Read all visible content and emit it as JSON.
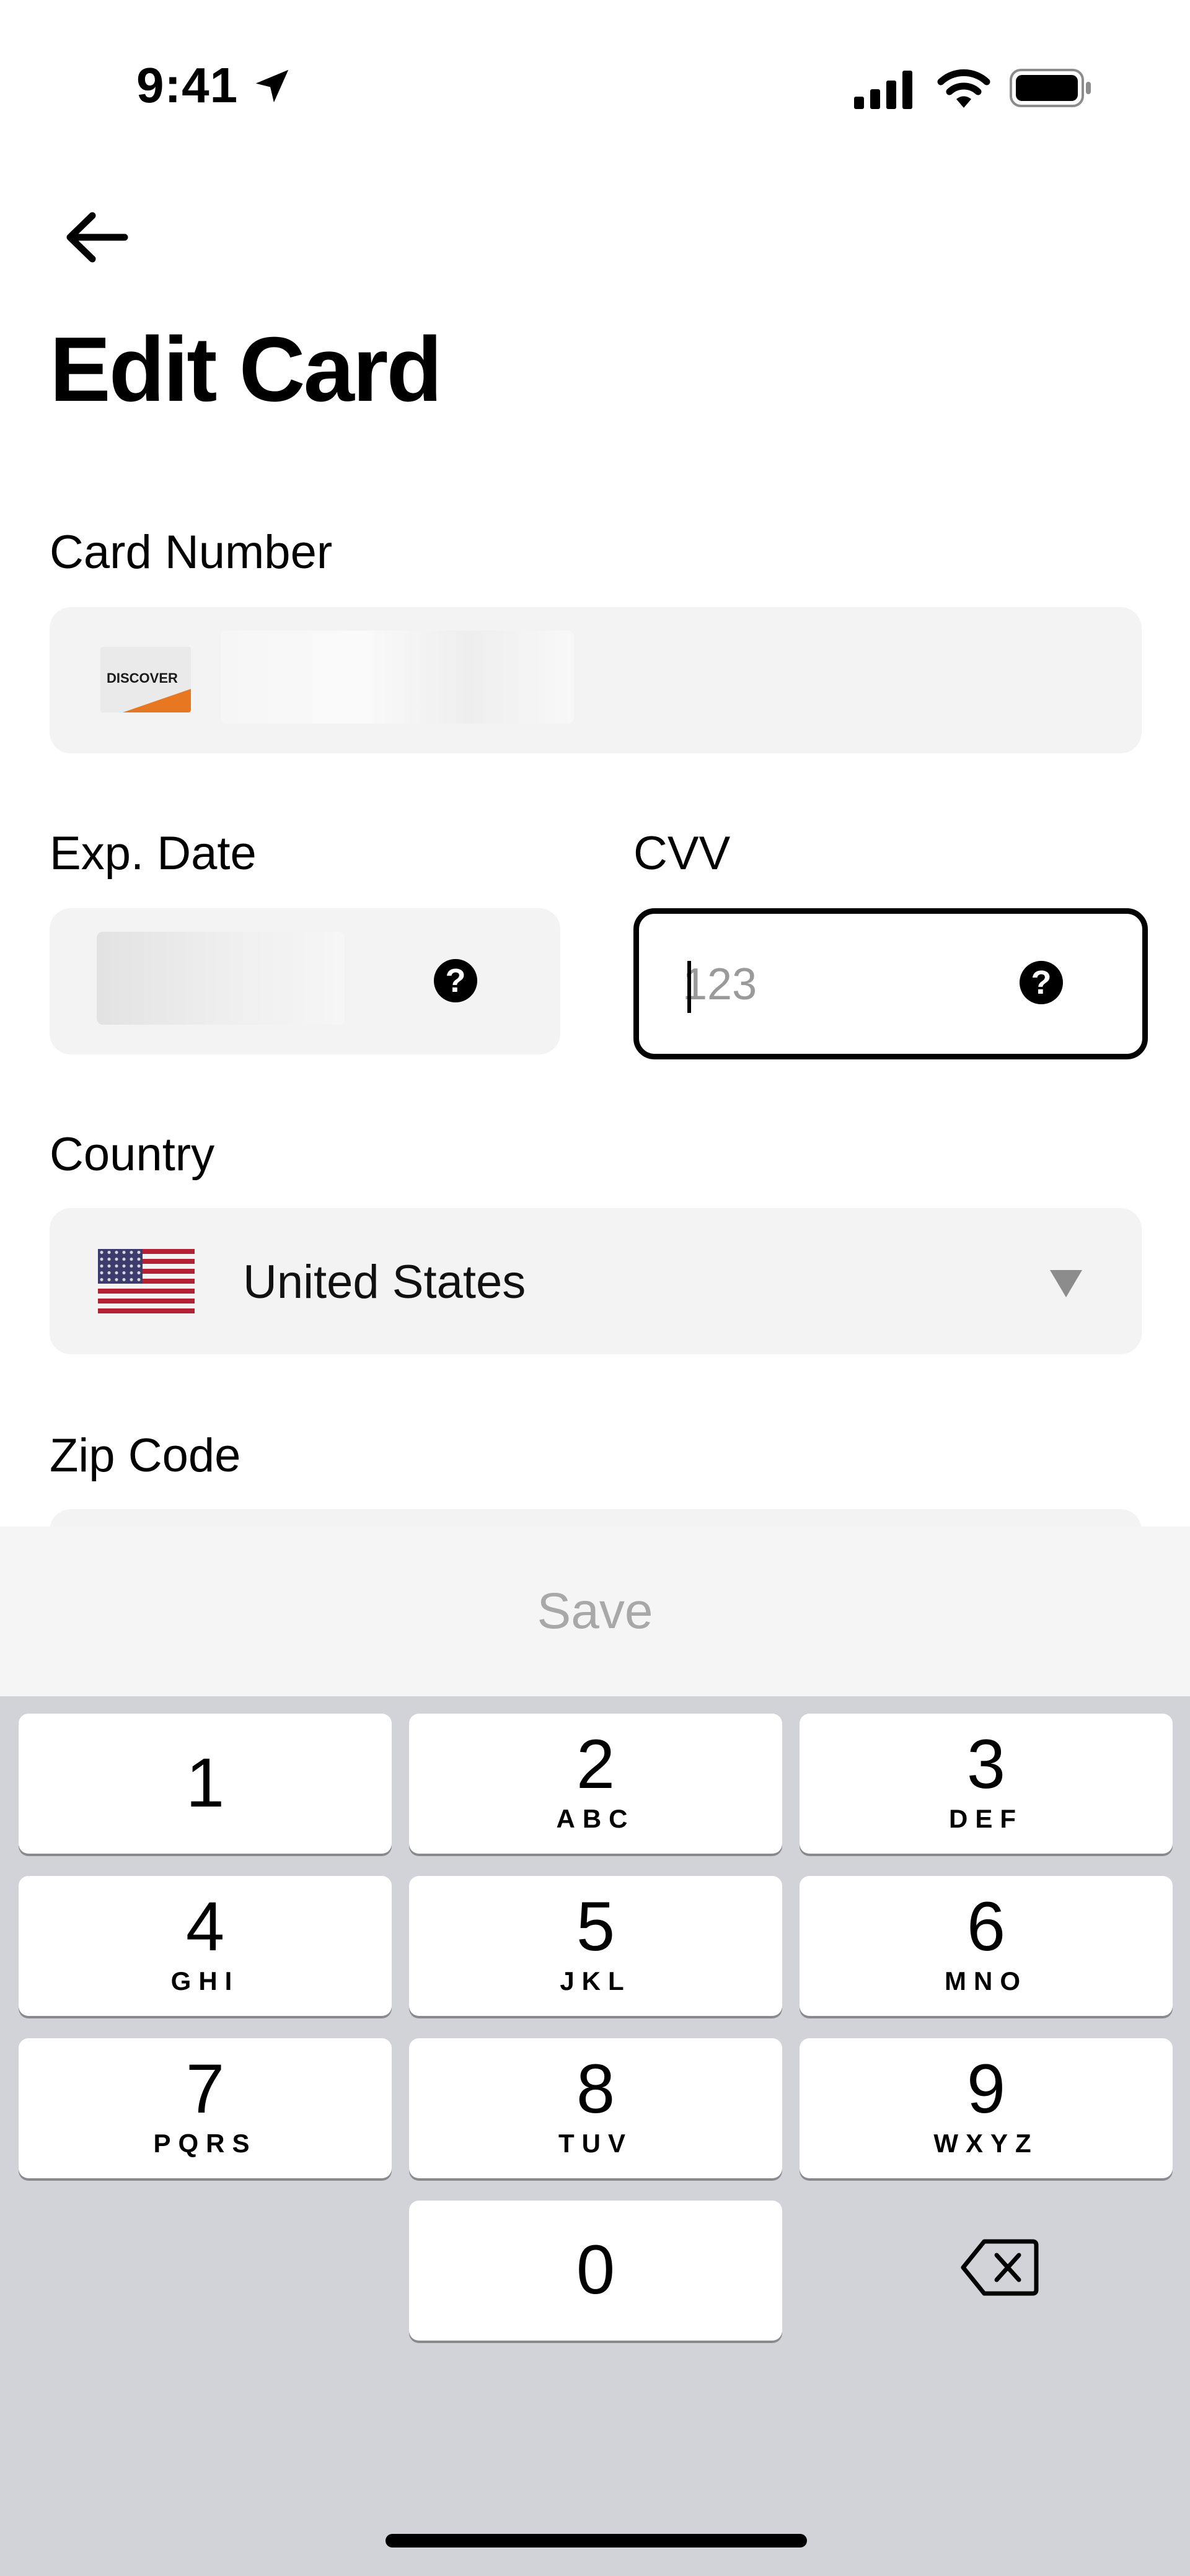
{
  "status_bar": {
    "time": "9:41"
  },
  "header": {
    "title": "Edit Card"
  },
  "form": {
    "card_number_label": "Card Number",
    "card_brand": "DISCOVER",
    "exp_date_label": "Exp. Date",
    "cvv_label": "CVV",
    "cvv_placeholder": "123",
    "country_label": "Country",
    "country_value": "United States",
    "zip_label": "Zip Code"
  },
  "actions": {
    "save_label": "Save"
  },
  "keypad": {
    "keys": [
      {
        "digit": "1",
        "letters": ""
      },
      {
        "digit": "2",
        "letters": "ABC"
      },
      {
        "digit": "3",
        "letters": "DEF"
      },
      {
        "digit": "4",
        "letters": "GHI"
      },
      {
        "digit": "5",
        "letters": "JKL"
      },
      {
        "digit": "6",
        "letters": "MNO"
      },
      {
        "digit": "7",
        "letters": "PQRS"
      },
      {
        "digit": "8",
        "letters": "TUV"
      },
      {
        "digit": "9",
        "letters": "WXYZ"
      },
      {
        "digit": "0",
        "letters": ""
      }
    ]
  },
  "icons": {
    "back": "arrow-left-icon",
    "location": "location-arrow-icon",
    "signal": "cellular-signal-icon",
    "wifi": "wifi-icon",
    "battery": "battery-icon",
    "help": "question-circle-icon",
    "dropdown": "triangle-down-icon",
    "delete": "backspace-icon"
  },
  "colors": {
    "discover_orange": "#e87722",
    "save_disabled": "#a8a8a8",
    "keyboard_bg": "#d1d3d9"
  }
}
